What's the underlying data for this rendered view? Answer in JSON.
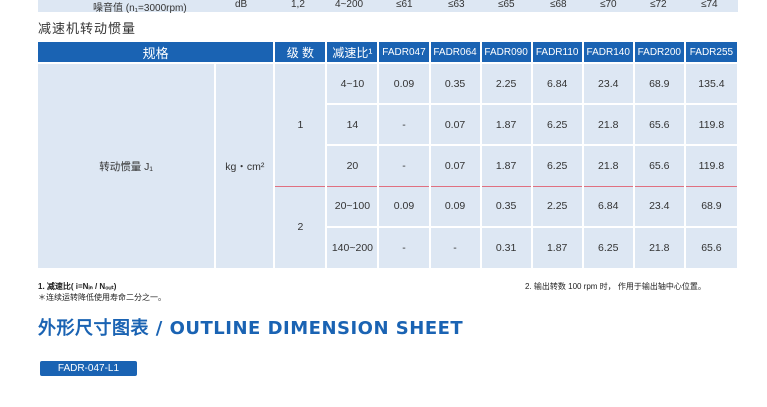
{
  "noise_row": {
    "label": "噪音值 (n₁=3000rpm)",
    "unit": "dB",
    "levels": "1,2",
    "ratio": "4~200",
    "values": [
      "≤61",
      "≤63",
      "≤65",
      "≤68",
      "≤70",
      "≤72",
      "≤74"
    ]
  },
  "section_title": "减速机转动惯量",
  "table": {
    "headers": {
      "spec": "规格",
      "level": "级 数",
      "ratio": "减速比¹",
      "models": [
        "FADR047",
        "FADR064",
        "FADR090",
        "FADR110",
        "FADR140",
        "FADR200",
        "FADR255"
      ]
    },
    "param_name": "转动惯量 J₁",
    "unit": "kg・cm²",
    "rows": [
      {
        "level": "1",
        "ratio": "4~10",
        "values": [
          "0.09",
          "0.35",
          "2.25",
          "6.84",
          "23.4",
          "68.9",
          "135.4"
        ]
      },
      {
        "level": "",
        "ratio": "14",
        "values": [
          "-",
          "0.07",
          "1.87",
          "6.25",
          "21.8",
          "65.6",
          "119.8"
        ]
      },
      {
        "level": "",
        "ratio": "20",
        "values": [
          "-",
          "0.07",
          "1.87",
          "6.25",
          "21.8",
          "65.6",
          "119.8"
        ]
      },
      {
        "level": "2",
        "ratio": "20~100",
        "values": [
          "0.09",
          "0.09",
          "0.35",
          "2.25",
          "6.84",
          "23.4",
          "68.9"
        ]
      },
      {
        "level": "",
        "ratio": "140~200",
        "values": [
          "-",
          "-",
          "0.31",
          "1.87",
          "6.25",
          "21.8",
          "65.6"
        ]
      }
    ]
  },
  "notes": {
    "note1": "1. 减速比( i=Nᵢₙ / Nₒᵤₜ)",
    "note1b": "＊连续运转降低使用寿命二分之一。",
    "note2": "2. 输出转数 100 rpm 时， 作用于输出轴中心位置。"
  },
  "outline_title": "外形尺寸图表 / OUTLINE DIMENSION SHEET",
  "model_badge": "FADR-047-L1"
}
